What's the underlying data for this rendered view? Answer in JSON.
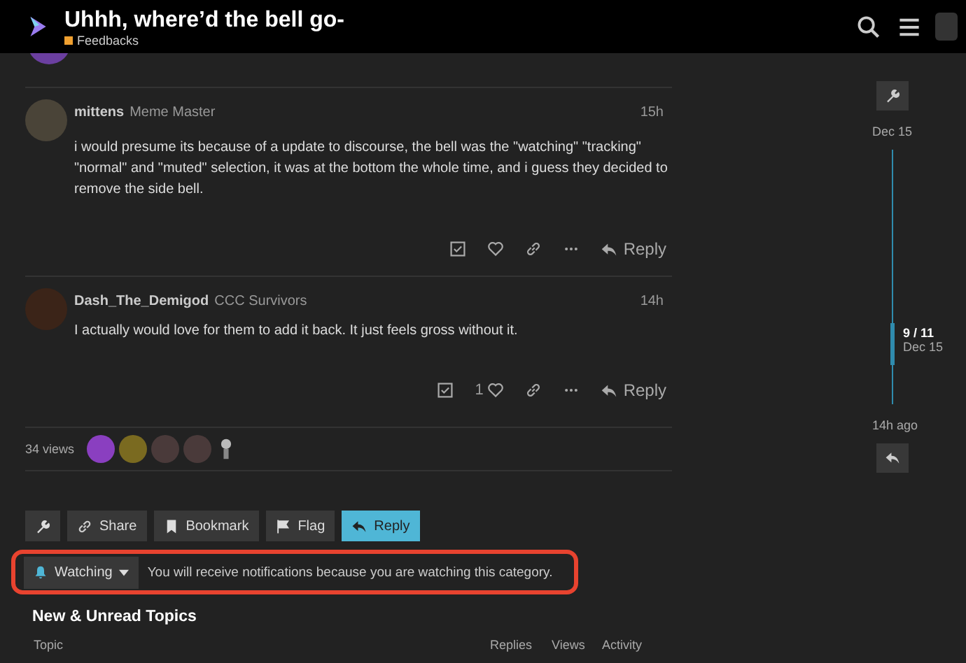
{
  "header": {
    "title": "Uhhh, where’d the bell go-",
    "category": {
      "name": "Feedbacks",
      "color": "#f0a030"
    }
  },
  "posts": [
    {
      "author": "mittens",
      "user_title": "Meme Master",
      "time": "15h",
      "body": "i would presume its because of a update to discourse, the bell was the \"watching\" \"tracking\" \"normal\" and \"muted\" selection, it was at the bottom the whole time, and i guess they decided to remove the side bell.",
      "reply": "Reply"
    },
    {
      "author": "Dash_The_Demigod",
      "user_title": "CCC Survivors",
      "time": "14h",
      "body": "I actually would love for them to add it back. It just feels gross without it.",
      "likes": "1",
      "reply": "Reply"
    }
  ],
  "views": "34 views",
  "footer_buttons": [
    {
      "kind": "wrench"
    },
    {
      "kind": "share",
      "label": "Share"
    },
    {
      "kind": "bookmark",
      "label": "Bookmark"
    },
    {
      "kind": "flag",
      "label": "Flag"
    },
    {
      "kind": "reply",
      "label": "Reply"
    }
  ],
  "notification": {
    "level": "Watching",
    "description": "You will receive notifications because you are watching this category."
  },
  "topics": {
    "heading": "New & Unread Topics",
    "columns": [
      "Topic",
      "Replies",
      "Views",
      "Activity"
    ]
  },
  "timeline": {
    "start": "Dec 15",
    "position": "9 / 11",
    "position_date": "Dec 15",
    "end": "14h ago"
  }
}
